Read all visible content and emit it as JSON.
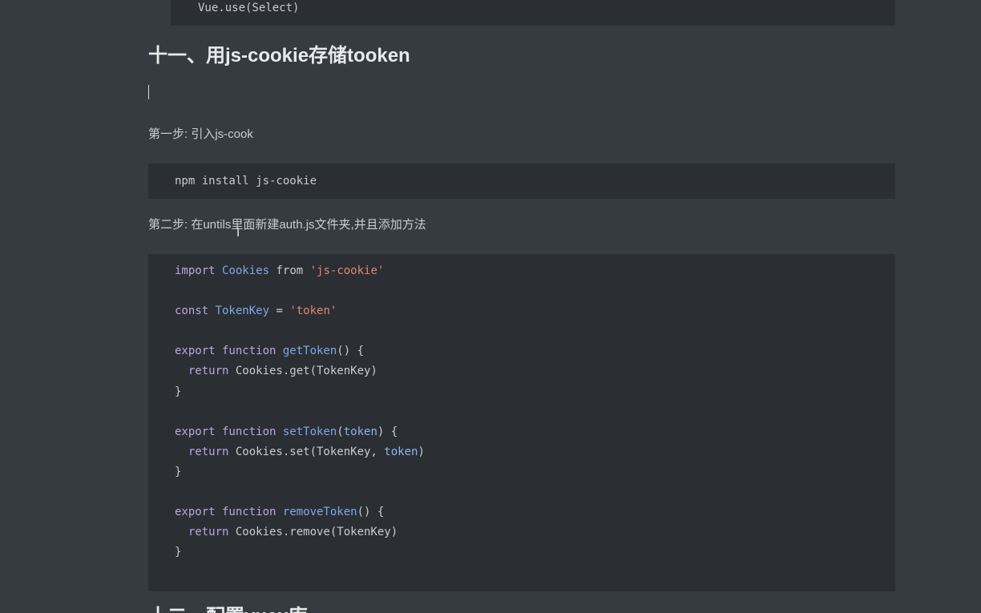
{
  "top_code": {
    "line": "Vue.use(Select)"
  },
  "section_heading": "十一、用js-cookie存储tooken",
  "step1": {
    "text": "第一步: 引入js-cook",
    "code": "npm install js-cookie"
  },
  "step2": {
    "text": "第二步: 在untils里面新建auth.js文件夹,并且添加方法"
  },
  "auth_code": {
    "lines": [
      [
        {
          "t": "kw",
          "v": "import "
        },
        {
          "t": "cls",
          "v": "Cookies"
        },
        {
          "t": "plain",
          "v": " from "
        },
        {
          "t": "str",
          "v": "'js-cookie'"
        }
      ],
      [],
      [
        {
          "t": "kw",
          "v": "const "
        },
        {
          "t": "cls",
          "v": "TokenKey"
        },
        {
          "t": "plain",
          "v": " = "
        },
        {
          "t": "str",
          "v": "'token'"
        }
      ],
      [],
      [
        {
          "t": "kw",
          "v": "export function "
        },
        {
          "t": "fn",
          "v": "getToken"
        },
        {
          "t": "plain",
          "v": "() {"
        }
      ],
      [
        {
          "t": "kw",
          "v": "  return "
        },
        {
          "t": "plain",
          "v": "Cookies.get(TokenKey)"
        }
      ],
      [
        {
          "t": "plain",
          "v": "}"
        }
      ],
      [],
      [
        {
          "t": "kw",
          "v": "export function "
        },
        {
          "t": "fn",
          "v": "setToken"
        },
        {
          "t": "plain",
          "v": "("
        },
        {
          "t": "param",
          "v": "token"
        },
        {
          "t": "plain",
          "v": ") {"
        }
      ],
      [
        {
          "t": "kw",
          "v": "  return "
        },
        {
          "t": "plain",
          "v": "Cookies.set(TokenKey, "
        },
        {
          "t": "param",
          "v": "token"
        },
        {
          "t": "plain",
          "v": ")"
        }
      ],
      [
        {
          "t": "plain",
          "v": "}"
        }
      ],
      [],
      [
        {
          "t": "kw",
          "v": "export function "
        },
        {
          "t": "fn",
          "v": "removeToken"
        },
        {
          "t": "plain",
          "v": "() {"
        }
      ],
      [
        {
          "t": "kw",
          "v": "  return "
        },
        {
          "t": "plain",
          "v": "Cookies.remove(TokenKey)"
        }
      ],
      [
        {
          "t": "plain",
          "v": "}"
        }
      ]
    ]
  },
  "next_heading": "十二、配置vuex库",
  "colors": {
    "background": "#363b41",
    "code_background": "#2b2f34",
    "keyword": "#b9a7de",
    "identifier": "#7fa7e6",
    "string": "#e08670"
  },
  "icons": {
    "text_cursor": "ibeam-cursor-icon"
  }
}
